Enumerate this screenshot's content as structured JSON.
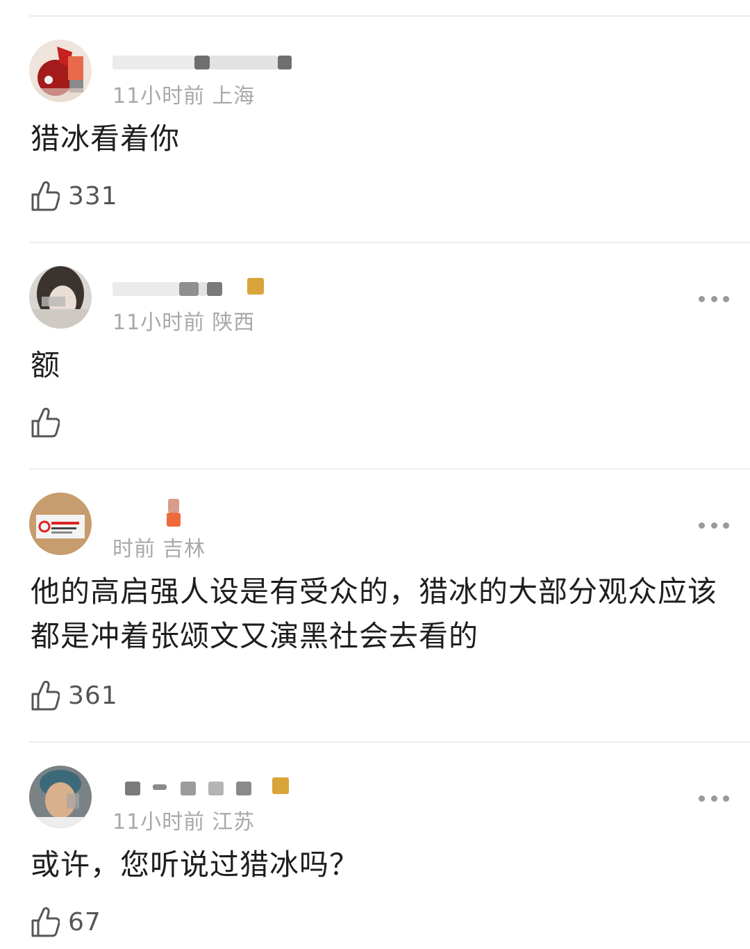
{
  "comments": [
    {
      "meta_time": "11小时前",
      "meta_location": "上海",
      "text": "猎冰看着你",
      "likes": "331",
      "show_more": false
    },
    {
      "meta_time": "11小时前",
      "meta_location": "陕西",
      "text": "额",
      "likes": "",
      "show_more": true
    },
    {
      "meta_time": "时前",
      "meta_location": "吉林",
      "text": "他的高启强人设是有受众的，猎冰的大部分观众应该都是冲着张颂文又演黑社会去看的",
      "likes": "361",
      "show_more": true
    },
    {
      "meta_time": "11小时前",
      "meta_location": "江苏",
      "text": "或许，您听说过猎冰吗？",
      "likes": "67",
      "show_more": true
    }
  ],
  "icons": {
    "like": "thumbs-up-icon",
    "more": "more-dots-icon"
  },
  "colors": {
    "meta_text": "#a8a8a8",
    "body_text": "#1e1e1e",
    "like_text": "#555555",
    "divider": "#ececec",
    "dots": "#9a9a9a"
  }
}
